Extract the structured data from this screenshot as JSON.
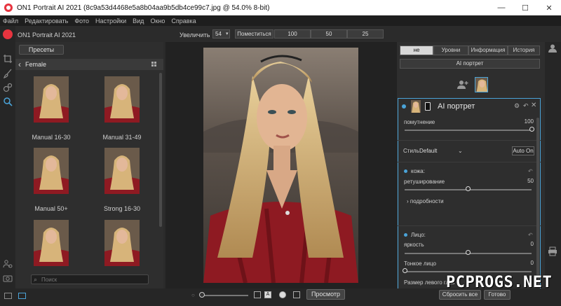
{
  "window": {
    "title": "ON1 Portrait AI 2021 (8c9a53d4468e5a8b04aa9b5db4ce99c7.jpg @ 54.0% 8-bit)",
    "minimize": "—",
    "maximize": "☐",
    "close": "✕"
  },
  "menu": [
    "Файл",
    "Редактировать",
    "Фото",
    "Настройки",
    "Вид",
    "Окно",
    "Справка"
  ],
  "brand": {
    "name": "ON1 Portrait AI 2021",
    "color": "#e7343f"
  },
  "toolbar_icons": [
    "crop-icon",
    "brush-icon",
    "mask-icon",
    "portrait-ai-icon",
    "people-icon",
    "camera-icon"
  ],
  "zoom": {
    "label": "Увеличить",
    "value": "54",
    "fit_label": "Поместиться",
    "presets": [
      "100",
      "50",
      "25"
    ]
  },
  "left_panel": {
    "tab_label": "Пресеты",
    "category": "Female",
    "presets": [
      {
        "label": "Manual 16-30"
      },
      {
        "label": "Manual 31-49"
      },
      {
        "label": "Manual 50+"
      },
      {
        "label": "Strong 16-30"
      },
      {
        "label": ""
      },
      {
        "label": ""
      }
    ],
    "search_placeholder": "Поиск"
  },
  "right_panel": {
    "tabs": [
      "не",
      "Уровни",
      "Информация",
      "История"
    ],
    "active_tab": 0,
    "ai_button": "AI портрет",
    "module": {
      "title": "AI портрет",
      "opacity_label": "помутнение",
      "opacity_value": "100",
      "opacity_fraction": 1.0,
      "style_label": "Стиль",
      "style_value": "Default",
      "auto_label": "Auto On",
      "skin": {
        "title": "кожа:",
        "retouch_label": "ретуширование",
        "retouch_value": "50",
        "retouch_fraction": 0.5,
        "details_label": "подробности"
      },
      "face": {
        "title": "Лицо:",
        "brightness_label": "яркость",
        "brightness_value": "0",
        "brightness_fraction": 0.5,
        "slim_label": "Тонкое лицо",
        "slim_value": "0",
        "slim_fraction": 0.0,
        "left_eye_label": "Размер левого глаз"
      }
    }
  },
  "bottom": {
    "preview_label": "Просмотр",
    "reset_label": "Сбросить все",
    "done_label": "Готово"
  },
  "watermark": "PCPROGS.NET",
  "accent_color": "#4aa3d8"
}
